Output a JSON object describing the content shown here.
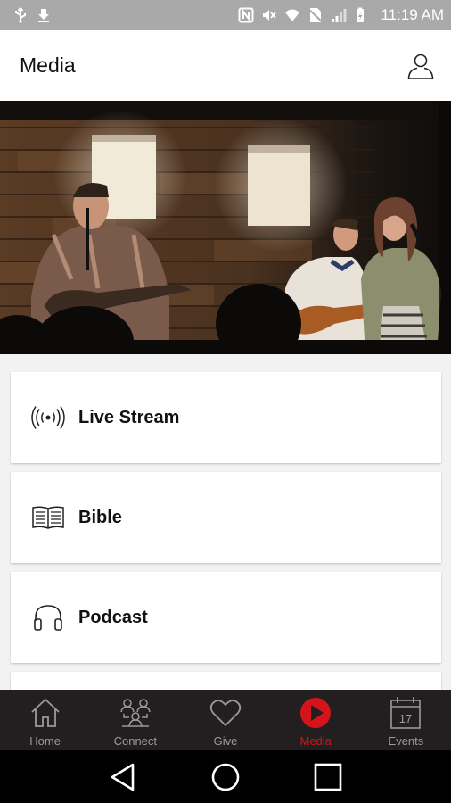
{
  "status_bar": {
    "time": "11:19 AM",
    "icons": [
      "usb-icon",
      "download-icon",
      "nfc-icon",
      "mute-icon",
      "wifi-icon",
      "no-sim-icon",
      "signal-icon",
      "battery-icon"
    ]
  },
  "app_bar": {
    "title": "Media",
    "profile_icon": "user-icon"
  },
  "hero": {
    "image": "worship-band-photo"
  },
  "media_items": [
    {
      "label": "Live Stream",
      "icon": "broadcast-icon"
    },
    {
      "label": "Bible",
      "icon": "book-icon"
    },
    {
      "label": "Podcast",
      "icon": "headphones-icon"
    }
  ],
  "tab_bar": {
    "tabs": [
      {
        "label": "Home",
        "icon": "home-icon",
        "active": false
      },
      {
        "label": "Connect",
        "icon": "people-icon",
        "active": false
      },
      {
        "label": "Give",
        "icon": "heart-icon",
        "active": false
      },
      {
        "label": "Media",
        "icon": "play-icon",
        "active": true
      },
      {
        "label": "Events",
        "icon": "calendar-icon",
        "active": false
      }
    ],
    "calendar_day": "17",
    "active_color": "#d4141a",
    "inactive_color": "#9a9a9a"
  },
  "nav_bar": {
    "buttons": [
      "back-icon",
      "home-circle-icon",
      "recents-icon"
    ]
  }
}
